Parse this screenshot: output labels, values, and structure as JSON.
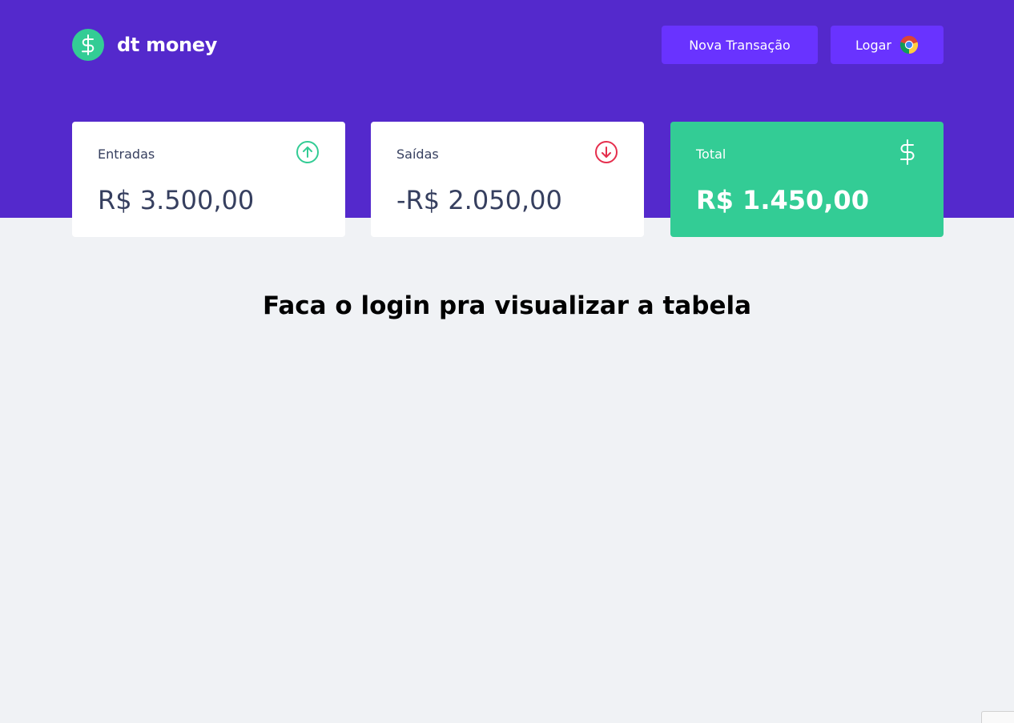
{
  "brand": {
    "name": "dt money",
    "logo_color": "#33cc95"
  },
  "header": {
    "background": "#5429cc",
    "new_transaction_label": "Nova Transação",
    "login_label": "Logar",
    "login_icon": "chrome-icon"
  },
  "summary": {
    "income": {
      "label": "Entradas",
      "value": "R$ 3.500,00",
      "icon": "arrow-up-circle-icon"
    },
    "outcome": {
      "label": "Saídas",
      "value": "-R$ 2.050,00",
      "icon": "arrow-down-circle-icon"
    },
    "total": {
      "label": "Total",
      "value": "R$ 1.450,00",
      "icon": "dollar-sign-icon",
      "background": "#33cc95"
    }
  },
  "main": {
    "login_message": "Faca o login pra visualizar a tabela"
  }
}
